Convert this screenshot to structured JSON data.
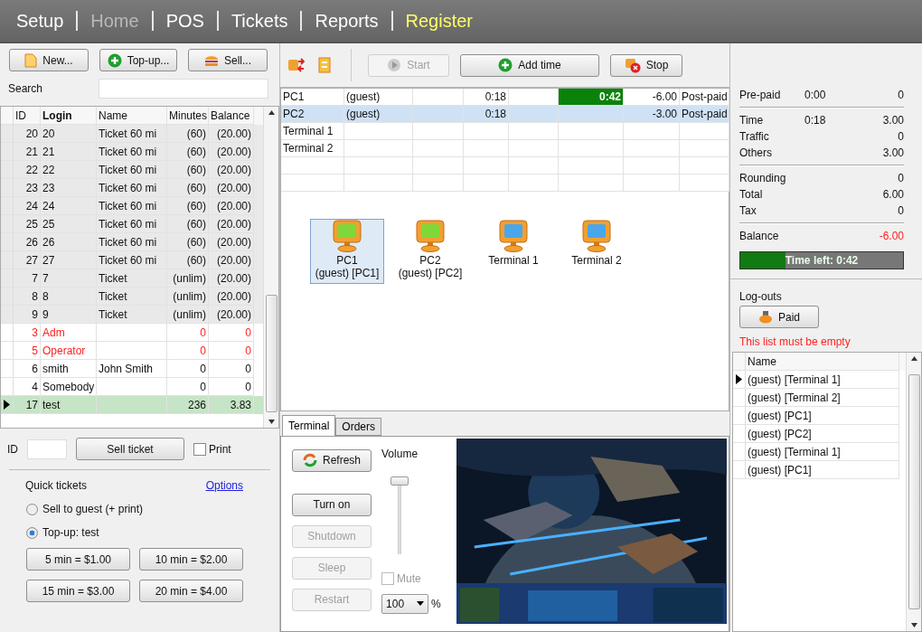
{
  "nav": [
    {
      "label": "Setup",
      "selected": false,
      "disabled": false
    },
    {
      "label": "Home",
      "selected": false,
      "disabled": true
    },
    {
      "label": "POS",
      "selected": false,
      "disabled": false
    },
    {
      "label": "Tickets",
      "selected": false,
      "disabled": false
    },
    {
      "label": "Reports",
      "selected": false,
      "disabled": false
    },
    {
      "label": "Register",
      "selected": true,
      "disabled": false
    }
  ],
  "left": {
    "buttons": [
      "New...",
      "Top-up...",
      "Sell..."
    ],
    "search": {
      "label": "Search"
    },
    "columns": [
      "ID",
      "Login",
      "Name",
      "Minutes",
      "Balance"
    ],
    "rows": [
      {
        "kind": "ticket",
        "selected": false,
        "cells": [
          "20",
          "20",
          "Ticket 60 mi",
          "(60)",
          "(20.00)"
        ]
      },
      {
        "kind": "ticket",
        "selected": false,
        "cells": [
          "21",
          "21",
          "Ticket 60 mi",
          "(60)",
          "(20.00)"
        ]
      },
      {
        "kind": "ticket",
        "selected": false,
        "cells": [
          "22",
          "22",
          "Ticket 60 mi",
          "(60)",
          "(20.00)"
        ]
      },
      {
        "kind": "ticket",
        "selected": false,
        "cells": [
          "23",
          "23",
          "Ticket 60 mi",
          "(60)",
          "(20.00)"
        ]
      },
      {
        "kind": "ticket",
        "selected": false,
        "cells": [
          "24",
          "24",
          "Ticket 60 mi",
          "(60)",
          "(20.00)"
        ]
      },
      {
        "kind": "ticket",
        "selected": false,
        "cells": [
          "25",
          "25",
          "Ticket 60 mi",
          "(60)",
          "(20.00)"
        ]
      },
      {
        "kind": "ticket",
        "selected": false,
        "cells": [
          "26",
          "26",
          "Ticket 60 mi",
          "(60)",
          "(20.00)"
        ]
      },
      {
        "kind": "ticket",
        "selected": false,
        "cells": [
          "27",
          "27",
          "Ticket 60 mi",
          "(60)",
          "(20.00)"
        ]
      },
      {
        "kind": "ticket",
        "selected": false,
        "cells": [
          "7",
          "7",
          "Ticket",
          "(unlim)",
          "(20.00)"
        ]
      },
      {
        "kind": "ticket",
        "selected": false,
        "cells": [
          "8",
          "8",
          "Ticket",
          "(unlim)",
          "(20.00)"
        ]
      },
      {
        "kind": "ticket",
        "selected": false,
        "cells": [
          "9",
          "9",
          "Ticket",
          "(unlim)",
          "(20.00)"
        ]
      },
      {
        "kind": "staff",
        "selected": false,
        "cells": [
          "3",
          "Adm",
          "",
          "0",
          "0"
        ]
      },
      {
        "kind": "staff",
        "selected": false,
        "cells": [
          "5",
          "Operator",
          "",
          "0",
          "0"
        ]
      },
      {
        "kind": "user",
        "selected": false,
        "cells": [
          "6",
          "smith",
          "John Smith",
          "0",
          "0"
        ]
      },
      {
        "kind": "user",
        "selected": false,
        "cells": [
          "4",
          "Somebody",
          "",
          "0",
          "0"
        ]
      },
      {
        "kind": "user",
        "selected": true,
        "cells": [
          "17",
          "test",
          "",
          "236",
          "3.83"
        ]
      }
    ],
    "id_label": "ID",
    "sell_ticket": "Sell ticket",
    "print": {
      "label": "Print",
      "checked": false
    },
    "quick": {
      "title": "Quick tickets",
      "options_link": "Options",
      "radios": [
        {
          "label": "Sell to guest (+ print)",
          "selected": false
        },
        {
          "label": "Top-up: test",
          "selected": true
        }
      ],
      "buttons": [
        "5 min = $1.00",
        "10 min = $2.00",
        "15 min = $3.00",
        "20 min = $4.00"
      ]
    }
  },
  "toolbar": [
    {
      "label": "Start",
      "disabled": true
    },
    {
      "label": "Add time",
      "disabled": false
    },
    {
      "label": "Stop",
      "disabled": false
    }
  ],
  "sessions": [
    {
      "selected": false,
      "remaining_alert": true,
      "cells": [
        "PC1",
        "(guest)",
        "",
        "0:18",
        "",
        "0:42",
        "-6.00",
        "Post-paid"
      ]
    },
    {
      "selected": true,
      "remaining_alert": false,
      "cells": [
        "PC2",
        "(guest)",
        "",
        "0:18",
        "",
        "",
        "-3.00",
        "Post-paid"
      ]
    },
    {
      "selected": false,
      "remaining_alert": false,
      "cells": [
        "Terminal 1",
        "",
        "",
        "",
        "",
        "",
        "",
        ""
      ]
    },
    {
      "selected": false,
      "remaining_alert": false,
      "cells": [
        "Terminal 2",
        "",
        "",
        "",
        "",
        "",
        "",
        ""
      ]
    }
  ],
  "computers": [
    {
      "name": "PC1",
      "user": "(guest) [PC1]",
      "online": true,
      "selected": true
    },
    {
      "name": "PC2",
      "user": "(guest) [PC2]",
      "online": true,
      "selected": false
    },
    {
      "name": "Terminal 1",
      "online": false,
      "selected": false
    },
    {
      "name": "Terminal 2",
      "online": false,
      "selected": false
    }
  ],
  "tabs": [
    {
      "label": "Terminal",
      "selected": true
    },
    {
      "label": "Orders",
      "selected": false
    }
  ],
  "terminal": {
    "buttons": [
      {
        "label": "Refresh",
        "disabled": false
      },
      {
        "label": "Turn on",
        "disabled": false
      },
      {
        "label": "Shutdown",
        "disabled": true
      },
      {
        "label": "Sleep",
        "disabled": true
      },
      {
        "label": "Restart",
        "disabled": true
      }
    ],
    "volume": {
      "label": "Volume",
      "level": 1,
      "mute": {
        "label": "Mute",
        "checked": false,
        "disabled": true
      },
      "value": "100",
      "unit": "%"
    }
  },
  "summary": {
    "groups": [
      [
        {
          "label": "Pre-paid",
          "time": "0:00",
          "amount": "0"
        }
      ],
      [
        {
          "label": "Time",
          "time": "0:18",
          "amount": "3.00"
        },
        {
          "label": "Traffic",
          "amount": "0"
        },
        {
          "label": "Others",
          "amount": "3.00"
        }
      ],
      [
        {
          "label": "Rounding",
          "amount": "0"
        },
        {
          "label": "Total",
          "amount": "6.00"
        },
        {
          "label": "Tax",
          "amount": "0"
        }
      ]
    ],
    "balance": {
      "label": "Balance",
      "amount": "-6.00",
      "negative": true
    },
    "time_left": {
      "label": "Time left: 0:42",
      "level": 0.28
    }
  },
  "logouts": {
    "title": "Log-outs",
    "paid": "Paid",
    "warning": "This list must be empty",
    "column": "Name",
    "items": [
      {
        "label": "(guest) [Terminal 1]",
        "selected": true
      },
      {
        "label": "(guest) [Terminal 2]",
        "selected": false
      },
      {
        "label": "(guest) [PC1]",
        "selected": false
      },
      {
        "label": "(guest) [PC2]",
        "selected": false
      },
      {
        "label": "(guest) [Terminal 1]",
        "selected": false
      },
      {
        "label": "(guest) [PC1]",
        "selected": false
      }
    ]
  }
}
